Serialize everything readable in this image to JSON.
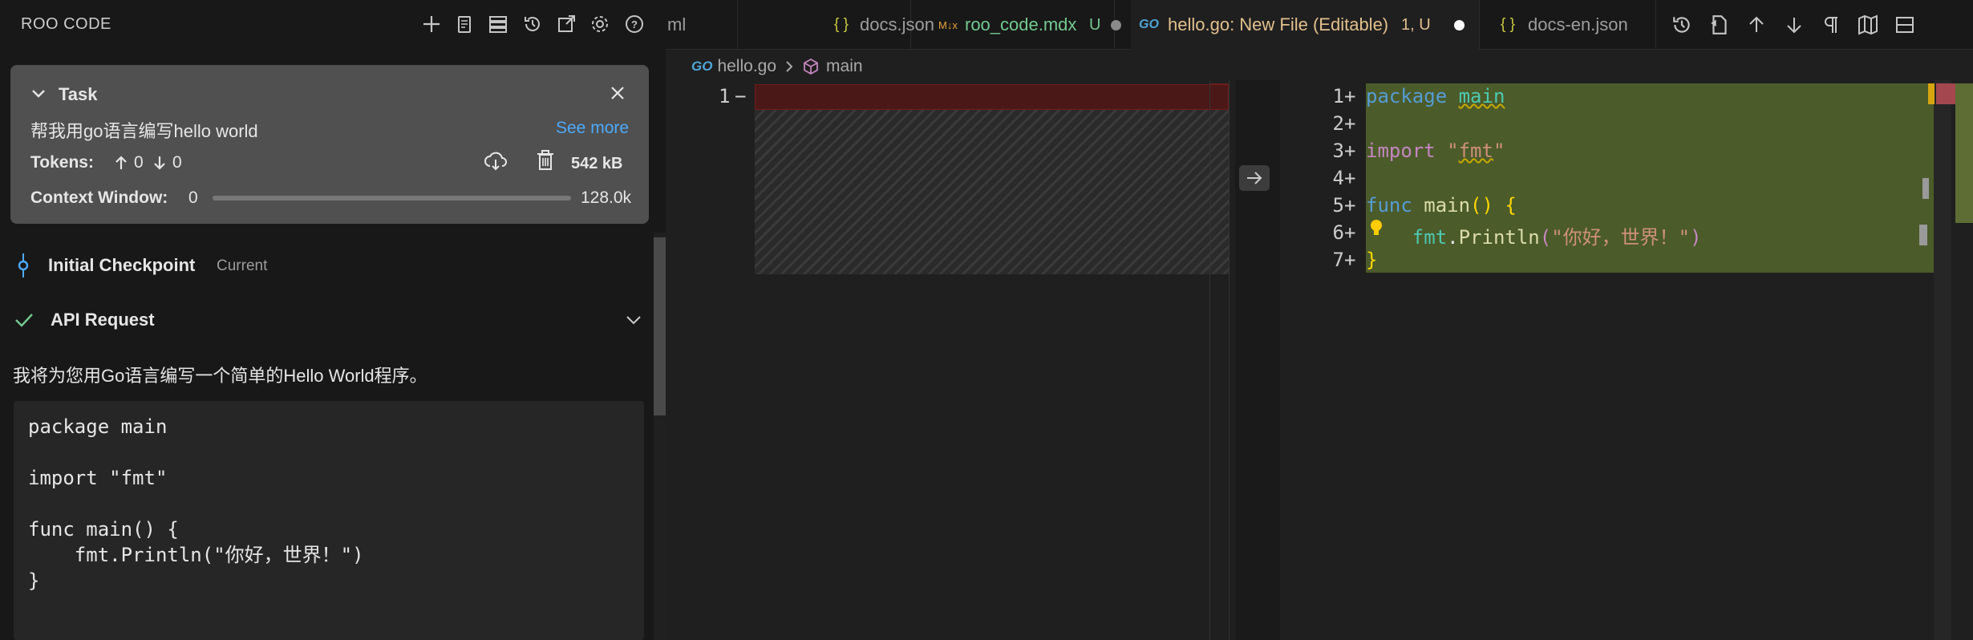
{
  "app": {
    "title": "ROO CODE"
  },
  "left_header_icons": [
    "plus-icon",
    "history-doc-icon",
    "servers-icon",
    "history-icon",
    "popout-icon",
    "gear-icon",
    "help-icon"
  ],
  "task": {
    "label": "Task",
    "text": "帮我用go语言编写hello world",
    "see_more": "See more",
    "tokens_label": "Tokens:",
    "tokens_up": "0",
    "tokens_down": "0",
    "size": "542 kB",
    "context_label": "Context Window:",
    "context_value": "0",
    "context_max": "128.0k",
    "context_progress": 0
  },
  "checkpoint": {
    "label": "Initial Checkpoint",
    "status": "Current"
  },
  "api_request": {
    "label": "API Request"
  },
  "response": {
    "text": "我将为您用Go语言编写一个简单的Hello World程序。",
    "code": "package main\n\nimport \"fmt\"\n\nfunc main() {\n    fmt.Println(\"你好，世界！\")\n}"
  },
  "tabs": [
    {
      "icon": "",
      "label": "ml",
      "status": ""
    },
    {
      "icon": "{ }",
      "label": "docs.json",
      "status": ""
    },
    {
      "icon": "M↓x",
      "label": "roo_code.mdx",
      "status": "U"
    },
    {
      "icon": "GO",
      "label": "hello.go: New File (Editable)",
      "status": "1, U"
    },
    {
      "icon": "{ }",
      "label": "docs-en.json",
      "status": ""
    }
  ],
  "breadcrumb": {
    "file": "hello.go",
    "symbol": "main"
  },
  "diff_left": {
    "line": "1",
    "marker": "−"
  },
  "diff_right": {
    "lines": [
      {
        "num": "1",
        "marker": "+"
      },
      {
        "num": "2",
        "marker": "+"
      },
      {
        "num": "3",
        "marker": "+"
      },
      {
        "num": "4",
        "marker": "+"
      },
      {
        "num": "5",
        "marker": "+"
      },
      {
        "num": "6",
        "marker": "+"
      },
      {
        "num": "7",
        "marker": "+"
      }
    ],
    "code": {
      "l1_kw": "package",
      "l1_id": "main",
      "l3_kw": "import",
      "l3_str_open": "\"",
      "l3_str": "fmt",
      "l3_str_close": "\"",
      "l5_kw": "func",
      "l5_fn": "main",
      "l5_paren": "()",
      "l5_brace": "{",
      "l6_pkg": "fmt",
      "l6_dot": ".",
      "l6_fn": "Println",
      "l6_open": "(",
      "l6_str": "\"你好，世界！\"",
      "l6_close": ")",
      "l7_brace": "}"
    }
  },
  "colors": {
    "accent_link": "#4daafc",
    "added_bg": "#4b5b2a",
    "removed_bg": "#4b1818",
    "modified_tab": "#e2c08d"
  }
}
